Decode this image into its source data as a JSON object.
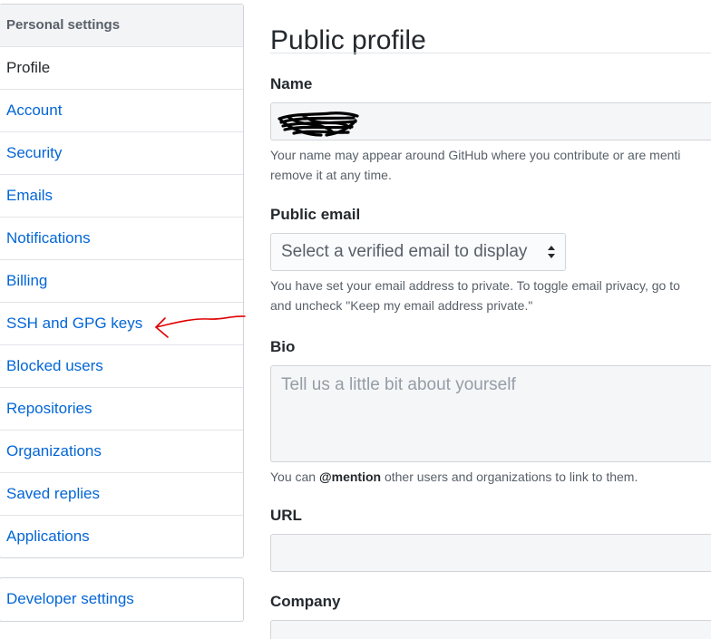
{
  "sidebar": {
    "header": "Personal settings",
    "items": [
      {
        "label": "Profile",
        "selected": true
      },
      {
        "label": "Account"
      },
      {
        "label": "Security"
      },
      {
        "label": "Emails"
      },
      {
        "label": "Notifications"
      },
      {
        "label": "Billing"
      },
      {
        "label": "SSH and GPG keys"
      },
      {
        "label": "Blocked users"
      },
      {
        "label": "Repositories"
      },
      {
        "label": "Organizations"
      },
      {
        "label": "Saved replies"
      },
      {
        "label": "Applications"
      }
    ],
    "developer_settings": "Developer settings"
  },
  "main": {
    "title": "Public profile",
    "name": {
      "label": "Name",
      "note_line1": "Your name may appear around GitHub where you contribute or are menti",
      "note_line2": "remove it at any time."
    },
    "public_email": {
      "label": "Public email",
      "selected": "Select a verified email to display",
      "note_line1": "You have set your email address to private. To toggle email privacy, go to",
      "note_line2": "and uncheck \"Keep my email address private.\""
    },
    "bio": {
      "label": "Bio",
      "placeholder": "Tell us a little bit about yourself",
      "note_prefix": "You can ",
      "note_mention": "@mention",
      "note_suffix": " other users and organizations to link to them."
    },
    "url": {
      "label": "URL"
    },
    "company": {
      "label": "Company"
    }
  },
  "colors": {
    "link": "#0366d6",
    "annotation": "#e00000",
    "redaction": "#000000"
  }
}
